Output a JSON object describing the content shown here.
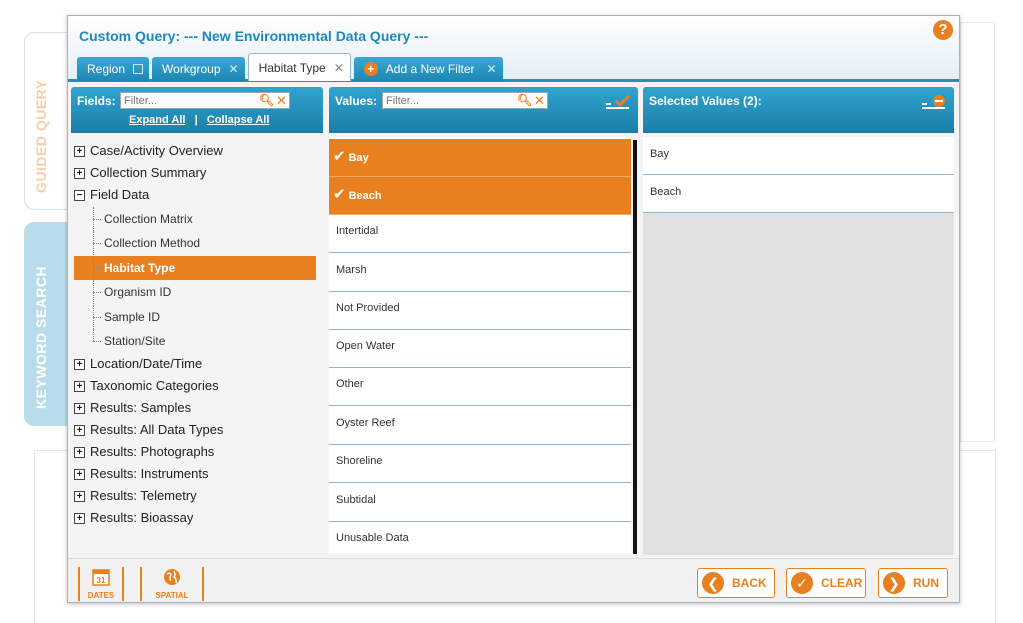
{
  "side_tabs": {
    "guided": "GUIDED QUERY",
    "keyword": "KEYWORD SEARCH"
  },
  "dialog": {
    "title": "Custom Query: --- New Environmental Data Query ---",
    "help": "?"
  },
  "tabs": [
    {
      "label": "Region"
    },
    {
      "label": "Workgroup"
    },
    {
      "label": "Habitat Type"
    },
    {
      "label": "Add a New Filter"
    }
  ],
  "fields_panel": {
    "label": "Fields:",
    "filter_placeholder": "Filter...",
    "expand_all": "Expand All",
    "separator": "|",
    "collapse_all": "Collapse All"
  },
  "values_panel": {
    "label": "Values:",
    "filter_placeholder": "Filter..."
  },
  "selected_panel": {
    "label": "Selected Values (2):"
  },
  "tree": {
    "case_activity": "Case/Activity Overview",
    "collection_summary": "Collection Summary",
    "field_data": "Field Data",
    "children": [
      "Collection Matrix",
      "Collection Method",
      "Habitat Type",
      "Organism ID",
      "Sample ID",
      "Station/Site"
    ],
    "groups": [
      "Location/Date/Time",
      "Taxonomic Categories",
      "Results: Samples",
      "Results: All Data Types",
      "Results: Photographs",
      "Results: Instruments",
      "Results: Telemetry",
      "Results: Bioassay"
    ]
  },
  "values": [
    "Bay",
    "Beach",
    "Intertidal",
    "Marsh",
    "Not Provided",
    "Open Water",
    "Other",
    "Oyster Reef",
    "Shoreline",
    "Subtidal",
    "Unusable Data"
  ],
  "selected_values": [
    "Bay",
    "Beach"
  ],
  "footer": {
    "dates_num": "31",
    "dates_label": "DATES",
    "spatial_label": "SPATIAL",
    "back": "BACK",
    "clear": "CLEAR",
    "run": "RUN"
  },
  "colors": {
    "accent": "#e8801f",
    "header_blue": "#1e86b3",
    "title_blue": "#1a8abb"
  }
}
